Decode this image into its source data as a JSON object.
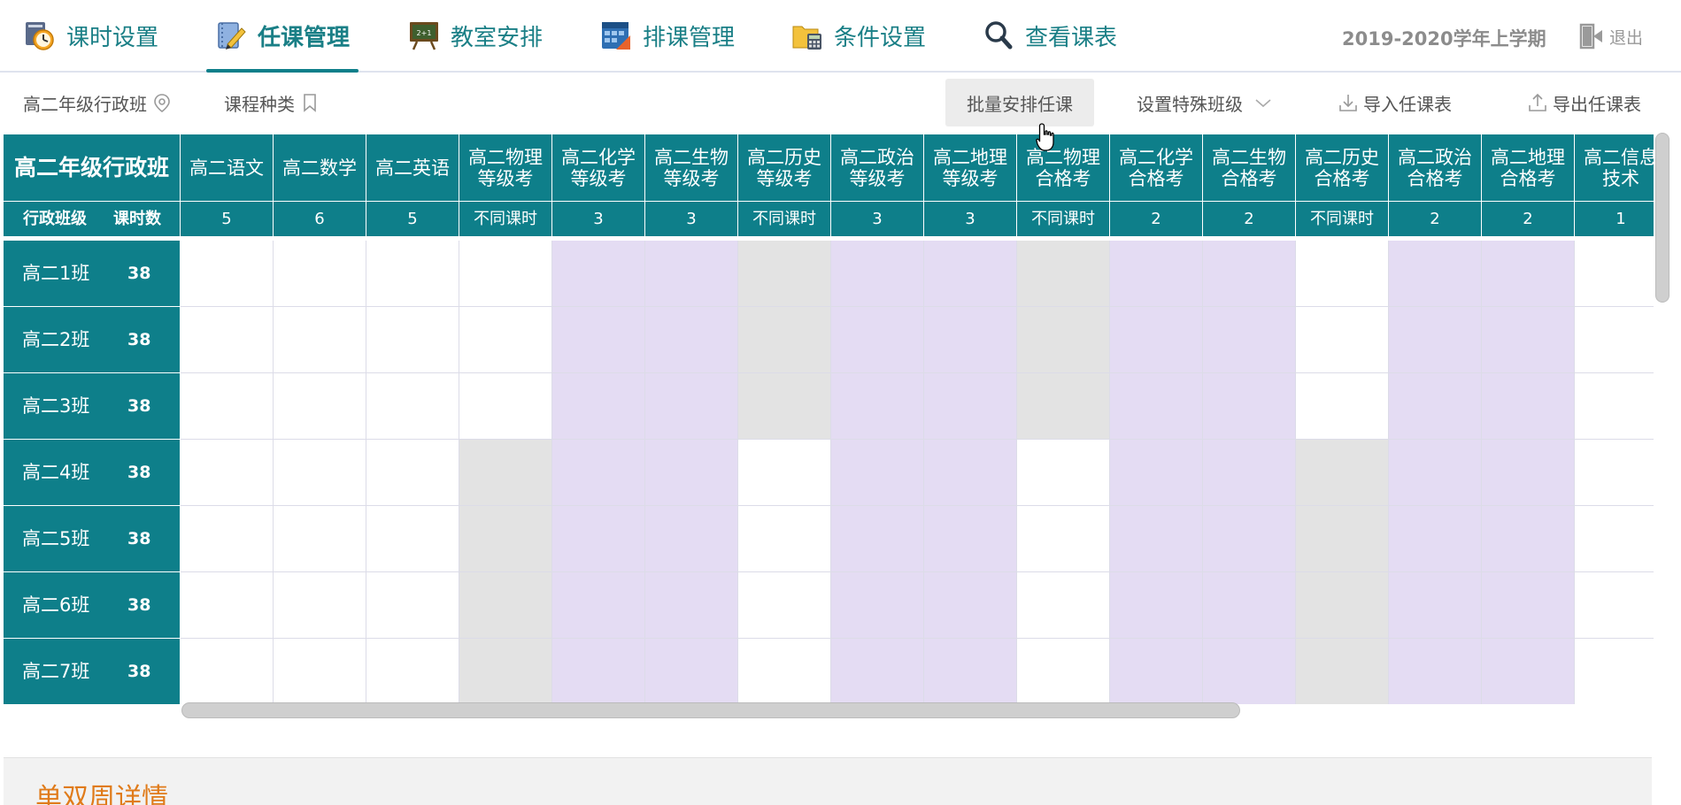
{
  "nav": {
    "items": [
      {
        "label": "课时设置",
        "icon": "clock-settings-icon"
      },
      {
        "label": "任课管理",
        "icon": "pen-notebook-icon"
      },
      {
        "label": "教室安排",
        "icon": "blackboard-icon"
      },
      {
        "label": "排课管理",
        "icon": "calendar-grid-icon"
      },
      {
        "label": "条件设置",
        "icon": "folder-calculator-icon"
      },
      {
        "label": "查看课表",
        "icon": "magnifier-icon"
      }
    ],
    "active_index": 1,
    "term": "2019-2020学年上学期",
    "logout": "退出"
  },
  "toolbar": {
    "grade_filter": "高二年级行政班",
    "course_type": "课程种类",
    "batch_assign": "批量安排任课",
    "special_class": "设置特殊班级",
    "import": "导入任课表",
    "export": "导出任课表"
  },
  "grid": {
    "corner_title": "高二年级行政班",
    "sub_left_a": "行政班级",
    "sub_left_b": "课时数",
    "courses": [
      {
        "name1": "高二语文",
        "name2": "",
        "hours": "5"
      },
      {
        "name1": "高二数学",
        "name2": "",
        "hours": "6"
      },
      {
        "name1": "高二英语",
        "name2": "",
        "hours": "5"
      },
      {
        "name1": "高二物理",
        "name2": "等级考",
        "hours": "不同课时"
      },
      {
        "name1": "高二化学",
        "name2": "等级考",
        "hours": "3"
      },
      {
        "name1": "高二生物",
        "name2": "等级考",
        "hours": "3"
      },
      {
        "name1": "高二历史",
        "name2": "等级考",
        "hours": "不同课时"
      },
      {
        "name1": "高二政治",
        "name2": "等级考",
        "hours": "3"
      },
      {
        "name1": "高二地理",
        "name2": "等级考",
        "hours": "3"
      },
      {
        "name1": "高二物理",
        "name2": "合格考",
        "hours": "不同课时"
      },
      {
        "name1": "高二化学",
        "name2": "合格考",
        "hours": "2"
      },
      {
        "name1": "高二生物",
        "name2": "合格考",
        "hours": "2"
      },
      {
        "name1": "高二历史",
        "name2": "合格考",
        "hours": "不同课时"
      },
      {
        "name1": "高二政治",
        "name2": "合格考",
        "hours": "2"
      },
      {
        "name1": "高二地理",
        "name2": "合格考",
        "hours": "2"
      },
      {
        "name1": "高二信息",
        "name2": "技术",
        "hours": "1"
      }
    ],
    "rows": [
      {
        "class": "高二1班",
        "hours": "38",
        "cells": [
          "w",
          "w",
          "w",
          "w",
          "p",
          "p",
          "g",
          "p",
          "p",
          "g",
          "p",
          "p",
          "w",
          "p",
          "p",
          "w"
        ]
      },
      {
        "class": "高二2班",
        "hours": "38",
        "cells": [
          "w",
          "w",
          "w",
          "w",
          "p",
          "p",
          "g",
          "p",
          "p",
          "g",
          "p",
          "p",
          "w",
          "p",
          "p",
          "w"
        ]
      },
      {
        "class": "高二3班",
        "hours": "38",
        "cells": [
          "w",
          "w",
          "w",
          "w",
          "p",
          "p",
          "g",
          "p",
          "p",
          "g",
          "p",
          "p",
          "w",
          "p",
          "p",
          "w"
        ]
      },
      {
        "class": "高二4班",
        "hours": "38",
        "cells": [
          "w",
          "w",
          "w",
          "g",
          "p",
          "p",
          "w",
          "p",
          "p",
          "w",
          "p",
          "p",
          "g",
          "p",
          "p",
          "w"
        ]
      },
      {
        "class": "高二5班",
        "hours": "38",
        "cells": [
          "w",
          "w",
          "w",
          "g",
          "p",
          "p",
          "w",
          "p",
          "p",
          "w",
          "p",
          "p",
          "g",
          "p",
          "p",
          "w"
        ]
      },
      {
        "class": "高二6班",
        "hours": "38",
        "cells": [
          "w",
          "w",
          "w",
          "g",
          "p",
          "p",
          "w",
          "p",
          "p",
          "w",
          "p",
          "p",
          "g",
          "p",
          "p",
          "w"
        ]
      },
      {
        "class": "高二7班",
        "hours": "38",
        "cells": [
          "w",
          "w",
          "w",
          "g",
          "p",
          "p",
          "w",
          "p",
          "p",
          "w",
          "p",
          "p",
          "g",
          "p",
          "p",
          "w"
        ]
      }
    ],
    "colors": {
      "header": "#0e7f8a",
      "purple": "#e4dcf3",
      "gray": "#e3e3e3"
    }
  },
  "bottom": {
    "title": "单双周详情"
  }
}
